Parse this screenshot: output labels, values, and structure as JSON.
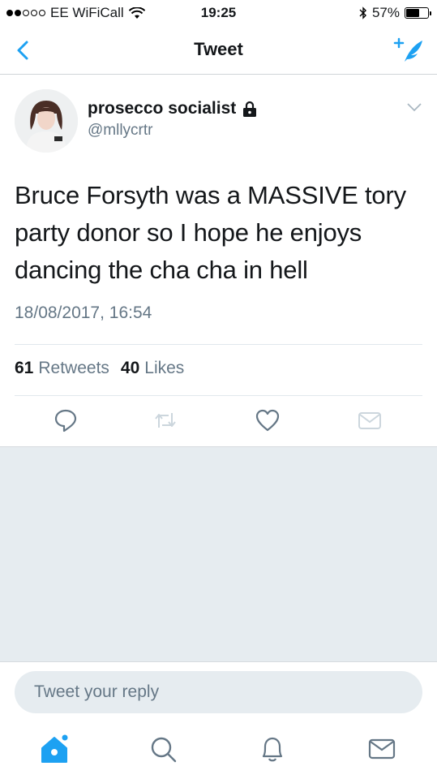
{
  "status_bar": {
    "carrier": "EE WiFiCall",
    "time": "19:25",
    "battery_percent": "57%",
    "battery_level": 0.57,
    "signal_bars_filled": 2,
    "signal_bars_total": 5
  },
  "nav": {
    "title": "Tweet",
    "back_icon": "chevron-left-icon",
    "compose_icon": "compose-tweet-icon"
  },
  "tweet": {
    "display_name": "prosecco socialist",
    "protected_icon": "lock-icon",
    "handle": "@mllycrtr",
    "text_lines": [
      "Bruce Forsyth was a MASSIVE tory",
      "party donor so I hope he enjoys",
      "dancing the cha cha in hell"
    ],
    "timestamp": "18/08/2017, 16:54"
  },
  "stats": {
    "retweets_count": "61",
    "retweets_label": "Retweets",
    "likes_count": "40",
    "likes_label": "Likes"
  },
  "actions": {
    "reply_icon": "reply-icon",
    "retweet_icon": "retweet-icon",
    "like_icon": "heart-icon",
    "dm_icon": "envelope-icon"
  },
  "reply": {
    "placeholder": "Tweet your reply"
  },
  "tabbar": {
    "tabs": [
      "home-icon",
      "search-icon",
      "notifications-icon",
      "messages-icon"
    ]
  },
  "colors": {
    "accent": "#1da1f2",
    "secondary_text": "#657786",
    "primary_text": "#14171a",
    "background_gray": "#e6ecf0"
  }
}
